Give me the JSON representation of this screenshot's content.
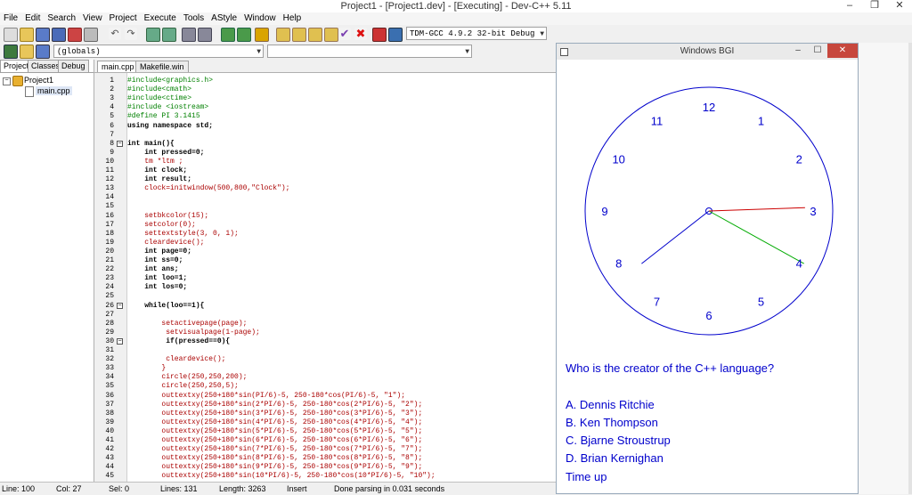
{
  "window": {
    "title": "Project1 - [Project1.dev] - [Executing] - Dev-C++ 5.11",
    "controls": [
      "–",
      "❐",
      "✕"
    ]
  },
  "menu": [
    "File",
    "Edit",
    "Search",
    "View",
    "Project",
    "Execute",
    "Tools",
    "AStyle",
    "Window",
    "Help"
  ],
  "toolbar": {
    "compiler_select": "TDM-GCC 4.9.2 32-bit Debug",
    "scope_select": "(globals)"
  },
  "left_panel": {
    "tabs": [
      "Project",
      "Classes",
      "Debug"
    ],
    "tree": {
      "project": "Project1",
      "file": "main.cpp"
    }
  },
  "editor": {
    "tabs": [
      "main.cpp",
      "Makefile.win"
    ],
    "lines": [
      {
        "n": "1",
        "code": "#include<graphics.h>"
      },
      {
        "n": "2",
        "code": "#include<cmath>"
      },
      {
        "n": "3",
        "code": "#include<ctime>"
      },
      {
        "n": "4",
        "code": "#include <iostream>"
      },
      {
        "n": "5",
        "code": "#define PI 3.1415"
      },
      {
        "n": "6",
        "code": "using namespace std;"
      },
      {
        "n": "7",
        "code": ""
      },
      {
        "n": "8",
        "code": "int main(){"
      },
      {
        "n": "9",
        "code": "    int pressed=0;"
      },
      {
        "n": "10",
        "code": "    tm *ltm ;"
      },
      {
        "n": "11",
        "code": "    int clock;"
      },
      {
        "n": "12",
        "code": "    int result;"
      },
      {
        "n": "13",
        "code": "    clock=initwindow(500,800,\"Clock\");"
      },
      {
        "n": "14",
        "code": ""
      },
      {
        "n": "15",
        "code": ""
      },
      {
        "n": "16",
        "code": "    setbkcolor(15);"
      },
      {
        "n": "17",
        "code": "    setcolor(0);"
      },
      {
        "n": "18",
        "code": "    settextstyle(3, 0, 1);"
      },
      {
        "n": "19",
        "code": "    cleardevice();"
      },
      {
        "n": "20",
        "code": "    int page=0;"
      },
      {
        "n": "21",
        "code": "    int ss=0;"
      },
      {
        "n": "22",
        "code": "    int ans;"
      },
      {
        "n": "23",
        "code": "    int loo=1;"
      },
      {
        "n": "24",
        "code": "    int los=0;"
      },
      {
        "n": "25",
        "code": ""
      },
      {
        "n": "26",
        "code": "    while(loo==1){"
      },
      {
        "n": "27",
        "code": ""
      },
      {
        "n": "28",
        "code": "        setactivepage(page);"
      },
      {
        "n": "29",
        "code": "         setvisualpage(1-page);"
      },
      {
        "n": "30",
        "code": "         if(pressed==0){"
      },
      {
        "n": "31",
        "code": ""
      },
      {
        "n": "32",
        "code": "         cleardevice();"
      },
      {
        "n": "33",
        "code": "        }"
      },
      {
        "n": "34",
        "code": "        circle(250,250,200);"
      },
      {
        "n": "35",
        "code": "        circle(250,250,5);"
      },
      {
        "n": "36",
        "code": "        outtextxy(250+180*sin(PI/6)-5, 250-180*cos(PI/6)-5, \"1\");"
      },
      {
        "n": "37",
        "code": "        outtextxy(250+180*sin(2*PI/6)-5, 250-180*cos(2*PI/6)-5, \"2\");"
      },
      {
        "n": "38",
        "code": "        outtextxy(250+180*sin(3*PI/6)-5, 250-180*cos(3*PI/6)-5, \"3\");"
      },
      {
        "n": "39",
        "code": "        outtextxy(250+180*sin(4*PI/6)-5, 250-180*cos(4*PI/6)-5, \"4\");"
      },
      {
        "n": "40",
        "code": "        outtextxy(250+180*sin(5*PI/6)-5, 250-180*cos(5*PI/6)-5, \"5\");"
      },
      {
        "n": "41",
        "code": "        outtextxy(250+180*sin(6*PI/6)-5, 250-180*cos(6*PI/6)-5, \"6\");"
      },
      {
        "n": "42",
        "code": "        outtextxy(250+180*sin(7*PI/6)-5, 250-180*cos(7*PI/6)-5, \"7\");"
      },
      {
        "n": "43",
        "code": "        outtextxy(250+180*sin(8*PI/6)-5, 250-180*cos(8*PI/6)-5, \"8\");"
      },
      {
        "n": "44",
        "code": "        outtextxy(250+180*sin(9*PI/6)-5, 250-180*cos(9*PI/6)-5, \"9\");"
      },
      {
        "n": "45",
        "code": "        outtextxy(250+180*sin(10*PI/6)-5, 250-180*cos(10*PI/6)-5, \"10\");"
      }
    ]
  },
  "bgi": {
    "title": "Windows BGI",
    "clock_numbers": [
      "12",
      "1",
      "2",
      "3",
      "4",
      "5",
      "6",
      "7",
      "8",
      "9",
      "10",
      "11"
    ],
    "question": "Who is the creator of the C++ language?",
    "options": [
      "A. Dennis Ritchie",
      "B. Ken Thompson",
      "C. Bjarne Stroustrup",
      "D. Brian Kernighan"
    ],
    "footer": "Time up",
    "colors": {
      "text": "#0000cc",
      "hour_hand": "#0000cc",
      "minute_hand": "#00aa00",
      "second_hand": "#cc0000"
    }
  },
  "status": {
    "line": "Line: 100",
    "col": "Col: 27",
    "sel": "Sel: 0",
    "lines": "Lines: 131",
    "length": "Length: 3263",
    "mode": "Insert",
    "message": "Done parsing in 0.031 seconds"
  }
}
